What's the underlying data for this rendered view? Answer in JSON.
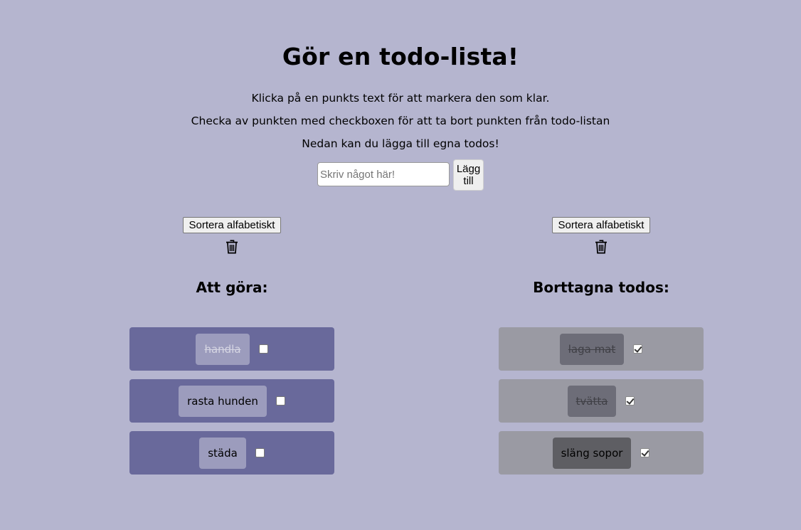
{
  "header": {
    "title": "Gör en todo-lista!",
    "line_1": "Klicka på en punkts text för att markera den som klar.",
    "line_2": "Checka av punkten med checkboxen för att ta bort punkten från todo-listan",
    "line_3": "Nedan kan du lägga till egna todos!"
  },
  "input": {
    "placeholder": "Skriv något här!",
    "value": "",
    "add_label": "Lägg till"
  },
  "todo_column": {
    "sort_label": "Sortera alfabetiskt",
    "trash_icon": "trash-icon",
    "heading": "Att göra:",
    "items": [
      {
        "text": "handla",
        "done": true,
        "checked": false
      },
      {
        "text": "rasta hunden",
        "done": false,
        "checked": false
      },
      {
        "text": "städa",
        "done": false,
        "checked": false
      }
    ]
  },
  "removed_column": {
    "sort_label": "Sortera alfabetiskt",
    "trash_icon": "trash-icon",
    "heading": "Borttagna todos:",
    "items": [
      {
        "text": "laga mat",
        "done": true,
        "checked": true
      },
      {
        "text": "tvätta",
        "done": true,
        "checked": true
      },
      {
        "text": "släng sopor",
        "done": false,
        "checked": true
      }
    ]
  },
  "colors": {
    "page_background": "#b5b5cf",
    "active_item": "#69699b",
    "removed_item": "#9a9aa3"
  }
}
